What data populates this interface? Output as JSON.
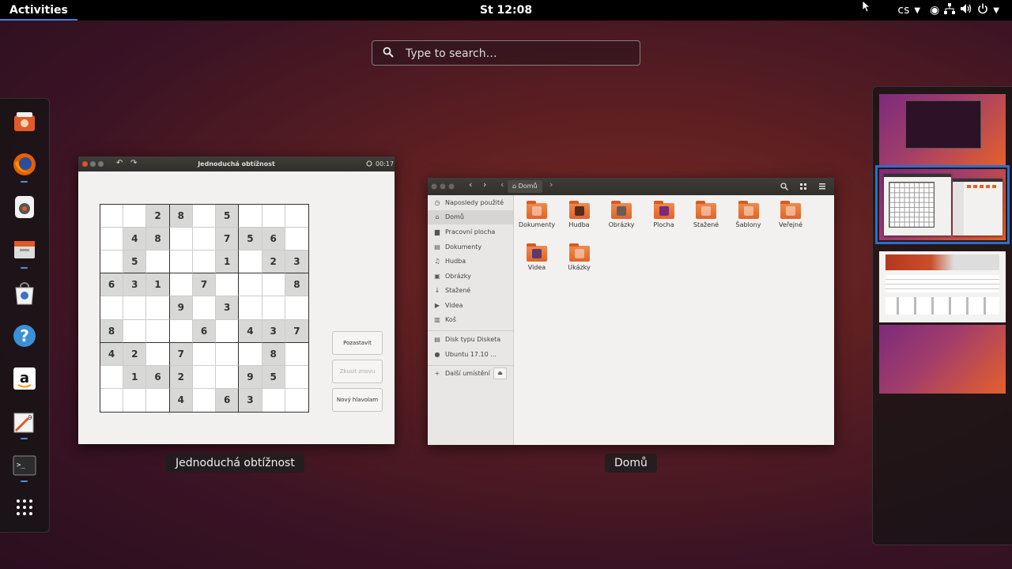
{
  "topbar": {
    "activities": "Activities",
    "clock": "St 12:08",
    "input_source": "cs"
  },
  "search": {
    "placeholder": "Type to search…"
  },
  "dash": {
    "items": [
      {
        "name": "software-center-icon"
      },
      {
        "name": "firefox-icon"
      },
      {
        "name": "rhythmbox-icon"
      },
      {
        "name": "files-icon"
      },
      {
        "name": "software-icon"
      },
      {
        "name": "help-icon"
      },
      {
        "name": "amazon-icon",
        "label": "a"
      },
      {
        "name": "sudoku-icon",
        "label": "9"
      },
      {
        "name": "terminal-icon",
        "label": ">_"
      },
      {
        "name": "show-applications-icon"
      }
    ]
  },
  "windows": {
    "sudoku": {
      "title": "Jednoduchá obtížnost",
      "timer": "00:17",
      "caption": "Jednoduchá obtížnost",
      "buttons": {
        "pause": "Pozastavit",
        "retry": "Zkusit znovu",
        "new": "Nový hlavolam"
      },
      "grid": [
        [
          "",
          "",
          "2",
          "8",
          "",
          "5",
          "",
          "",
          ""
        ],
        [
          "",
          "4",
          "8",
          "",
          "",
          "7",
          "5",
          "6",
          ""
        ],
        [
          "",
          "5",
          "",
          "",
          "",
          "1",
          "",
          "2",
          "3"
        ],
        [
          "6",
          "3",
          "1",
          "",
          "7",
          "",
          "",
          "",
          "8"
        ],
        [
          "",
          "",
          "",
          "9",
          "",
          "3",
          "",
          "",
          ""
        ],
        [
          "8",
          "",
          "",
          "",
          "6",
          "",
          "4",
          "3",
          "7"
        ],
        [
          "4",
          "2",
          "",
          "7",
          "",
          "",
          "",
          "8",
          ""
        ],
        [
          "",
          "1",
          "6",
          "2",
          "",
          "",
          "9",
          "5",
          ""
        ],
        [
          "",
          "",
          "",
          "4",
          "",
          "6",
          "3",
          "",
          ""
        ]
      ]
    },
    "files": {
      "caption": "Domů",
      "location": "Domů",
      "sidebar": [
        {
          "label": "Naposledy použité",
          "icon": "recent-icon"
        },
        {
          "label": "Domů",
          "icon": "home-icon",
          "selected": true
        },
        {
          "label": "Pracovní plocha",
          "icon": "desktop-icon"
        },
        {
          "label": "Dokumenty",
          "icon": "documents-icon"
        },
        {
          "label": "Hudba",
          "icon": "music-icon"
        },
        {
          "label": "Obrázky",
          "icon": "pictures-icon"
        },
        {
          "label": "Stažené",
          "icon": "downloads-icon"
        },
        {
          "label": "Videa",
          "icon": "videos-icon"
        },
        {
          "label": "Koš",
          "icon": "trash-icon"
        },
        {
          "label": "Disk typu Disketa",
          "icon": "floppy-icon"
        },
        {
          "label": "Ubuntu 17.10 ...",
          "icon": "disc-icon"
        },
        {
          "label": "Další umístění",
          "icon": "plus-icon"
        }
      ],
      "folders": [
        {
          "label": "Dokumenty"
        },
        {
          "label": "Hudba"
        },
        {
          "label": "Obrázky"
        },
        {
          "label": "Plocha"
        },
        {
          "label": "Stažené"
        },
        {
          "label": "Šablony"
        },
        {
          "label": "Veřejné"
        },
        {
          "label": "Videa"
        },
        {
          "label": "Ukázky"
        }
      ]
    }
  },
  "workspaces": [
    {
      "name": "workspace-1"
    },
    {
      "name": "workspace-2",
      "active": true
    },
    {
      "name": "workspace-3"
    },
    {
      "name": "workspace-4"
    }
  ]
}
